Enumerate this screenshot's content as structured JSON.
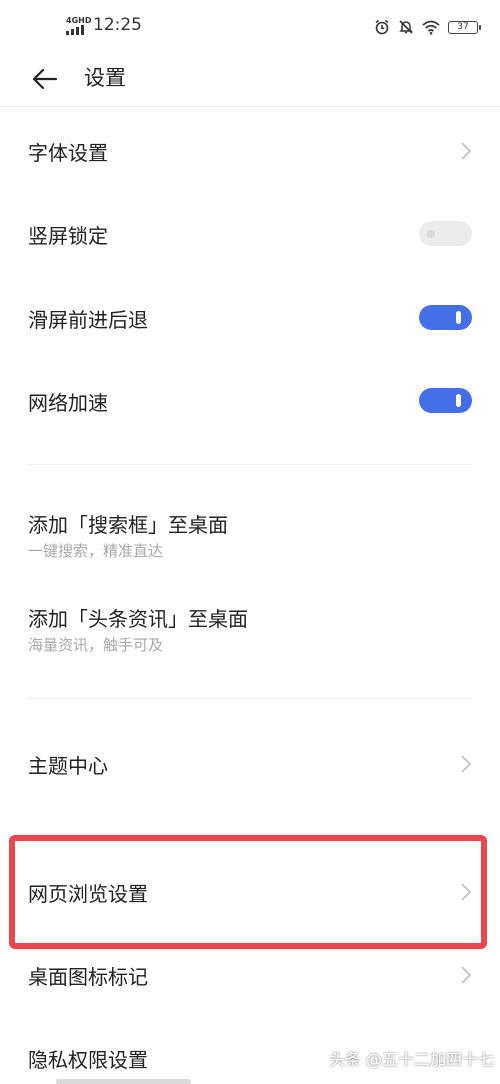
{
  "status_bar": {
    "network": "4G",
    "network_sup": "HD",
    "time": "12:25",
    "battery": "37"
  },
  "header": {
    "title": "设置",
    "back_icon": "arrow-left-icon"
  },
  "rows": {
    "font_settings": {
      "label": "字体设置"
    },
    "portrait_lock": {
      "label": "竖屏锁定",
      "toggle": "off-disabled"
    },
    "swipe_nav": {
      "label": "滑屏前进后退",
      "toggle": "on"
    },
    "network_boost": {
      "label": "网络加速",
      "toggle": "on"
    },
    "add_search": {
      "label": "添加「搜索框」至桌面",
      "subtitle": "一键搜索，精准直达"
    },
    "add_news": {
      "label": "添加「头条资讯」至桌面",
      "subtitle": "海量资讯，触手可及"
    },
    "theme_center": {
      "label": "主题中心"
    },
    "web_browse": {
      "label": "网页浏览设置"
    },
    "desktop_icon": {
      "label": "桌面图标标记"
    },
    "privacy": {
      "label": "隐私权限设置"
    }
  },
  "colors": {
    "toggle_on": "#456fe6",
    "highlight": "#e8474c"
  },
  "watermark": "头条 @五十二加四十七"
}
